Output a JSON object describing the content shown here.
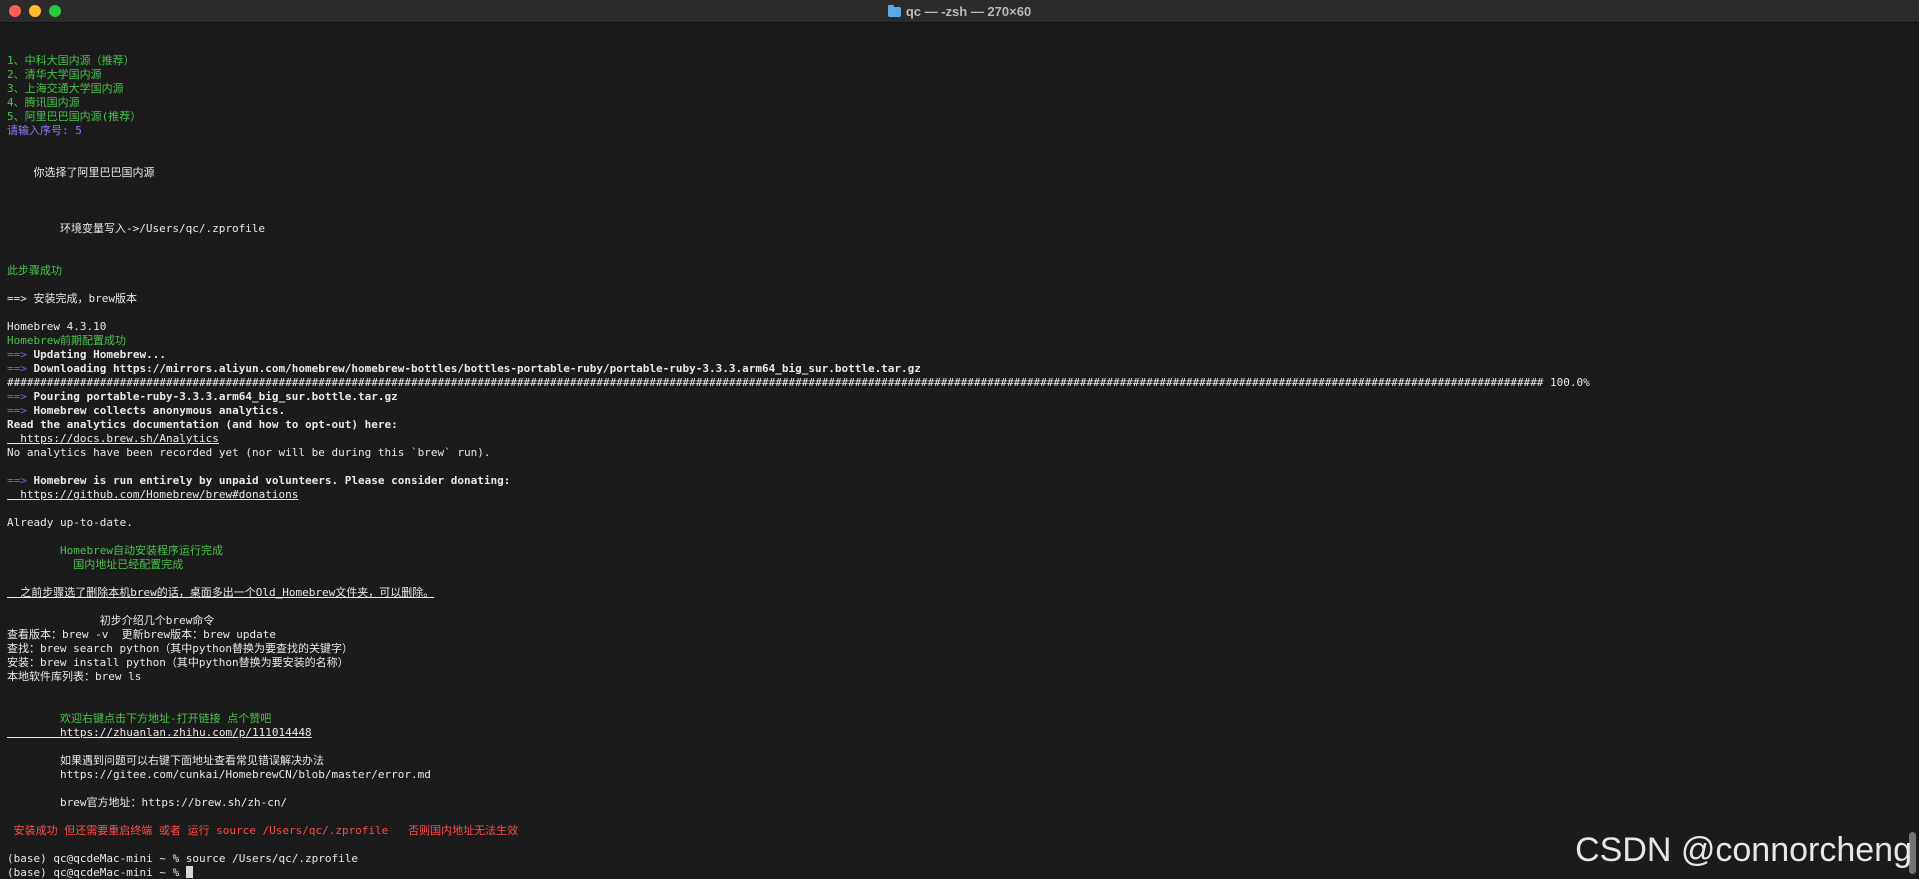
{
  "window": {
    "title": "qc — -zsh — 270×60"
  },
  "terminal": {
    "lines": [
      {
        "text": "",
        "color": "white"
      },
      {
        "text": "1、中科大国内源（推荐）",
        "color": "green"
      },
      {
        "text": "2、清华大学国内源",
        "color": "green"
      },
      {
        "text": "3、上海交通大学国内源",
        "color": "green"
      },
      {
        "text": "4、腾讯国内源",
        "color": "green"
      },
      {
        "text": "5、阿里巴巴国内源(推荐）",
        "color": "green"
      },
      {
        "text": "请输入序号: 5",
        "color": "purple"
      },
      {
        "text": "",
        "color": "white"
      },
      {
        "text": "",
        "color": "white"
      },
      {
        "text": "    你选择了阿里巴巴国内源",
        "color": "white"
      },
      {
        "text": "",
        "color": "white"
      },
      {
        "text": "",
        "color": "white"
      },
      {
        "text": "",
        "color": "white"
      },
      {
        "text": "        环境变量写入->/Users/qc/.zprofile",
        "color": "white"
      },
      {
        "text": "",
        "color": "white"
      },
      {
        "text": "",
        "color": "white"
      },
      {
        "text": "此步骤成功",
        "color": "green"
      },
      {
        "text": "",
        "color": "white"
      },
      {
        "text": "==> 安装完成，brew版本",
        "color": "white"
      },
      {
        "text": "",
        "color": "white"
      },
      {
        "text": "Homebrew 4.3.10",
        "color": "white"
      },
      {
        "text": "Homebrew前期配置成功",
        "color": "green"
      },
      {
        "text": "==> Updating Homebrew...",
        "color": "white",
        "prefix": "==>",
        "bold": true
      },
      {
        "text": "==> Downloading https://mirrors.aliyun.com/homebrew/homebrew-bottles/bottles-portable-ruby/portable-ruby-3.3.3.arm64_big_sur.bottle.tar.gz",
        "color": "white",
        "prefix": "==>",
        "bold": true
      },
      {
        "text": "######################################################################################################################################################################################################################################## 100.0%",
        "color": "white"
      },
      {
        "text": "==> Pouring portable-ruby-3.3.3.arm64_big_sur.bottle.tar.gz",
        "color": "white",
        "prefix": "==>",
        "bold": true
      },
      {
        "text": "==> Homebrew collects anonymous analytics.",
        "color": "white",
        "prefix": "==>",
        "bold": true
      },
      {
        "text": "Read the analytics documentation (and how to opt-out) here:",
        "color": "white",
        "bold": true
      },
      {
        "text": "  https://docs.brew.sh/Analytics",
        "color": "white",
        "underline": true
      },
      {
        "text": "No analytics have been recorded yet (nor will be during this `brew` run).",
        "color": "white"
      },
      {
        "text": "",
        "color": "white"
      },
      {
        "text": "==> Homebrew is run entirely by unpaid volunteers. Please consider donating:",
        "color": "white",
        "prefix": "==>",
        "bold": true
      },
      {
        "text": "  https://github.com/Homebrew/brew#donations",
        "color": "white",
        "underline": true
      },
      {
        "text": "",
        "color": "white"
      },
      {
        "text": "Already up-to-date.",
        "color": "white"
      },
      {
        "text": "",
        "color": "white"
      },
      {
        "text": "        Homebrew自动安装程序运行完成",
        "color": "green"
      },
      {
        "text": "          国内地址已经配置完成",
        "color": "green"
      },
      {
        "text": "",
        "color": "white"
      },
      {
        "text": "  之前步骤选了删除本机brew的话，桌面多出一个Old_Homebrew文件夹，可以删除。",
        "color": "white",
        "underline": true
      },
      {
        "text": "",
        "color": "white"
      },
      {
        "text": "              初步介绍几个brew命令",
        "color": "white"
      },
      {
        "text": "查看版本：brew -v  更新brew版本：brew update",
        "color": "white"
      },
      {
        "text": "查找：brew search python（其中python替换为要查找的关键字）",
        "color": "white"
      },
      {
        "text": "安装：brew install python（其中python替换为要安装的名称）",
        "color": "white"
      },
      {
        "text": "本地软件库列表：brew ls",
        "color": "white"
      },
      {
        "text": "",
        "color": "white"
      },
      {
        "text": "",
        "color": "white"
      },
      {
        "text": "        欢迎右键点击下方地址-打开链接 点个赞吧",
        "color": "green"
      },
      {
        "text": "        https://zhuanlan.zhihu.com/p/111014448",
        "color": "white",
        "underline": true
      },
      {
        "text": "",
        "color": "white"
      },
      {
        "text": "        如果遇到问题可以右键下面地址查看常见错误解决办法",
        "color": "white"
      },
      {
        "text": "        https://gitee.com/cunkai/HomebrewCN/blob/master/error.md",
        "color": "white"
      },
      {
        "text": "",
        "color": "white"
      },
      {
        "text": "        brew官方地址：https://brew.sh/zh-cn/",
        "color": "white"
      },
      {
        "text": "",
        "color": "white"
      },
      {
        "text": " 安装成功 但还需要重启终端 或者 运行 source /Users/qc/.zprofile   否则国内地址无法生效",
        "color": "red"
      },
      {
        "text": "",
        "color": "white"
      },
      {
        "text": "(base) qc@qcdeMac-mini ~ % source /Users/qc/.zprofile",
        "color": "white"
      },
      {
        "text": "(base) qc@qcdeMac-mini ~ % ",
        "color": "white",
        "cursor": true
      }
    ]
  },
  "overlay": {
    "watermark": "CSDN @connorcheng"
  },
  "colors": {
    "background": "#1b1b1b",
    "green": "#48c34a",
    "purple": "#8a7cff",
    "blue": "#5d6dff",
    "red": "#ff4a4a"
  }
}
